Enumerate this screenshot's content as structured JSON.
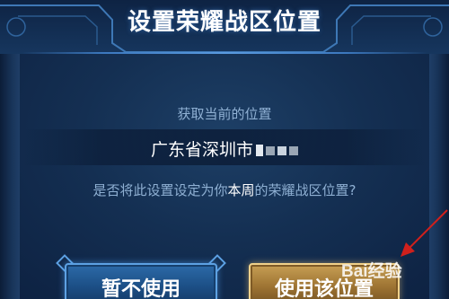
{
  "dialog": {
    "title": "设置荣耀战区位置",
    "prompt": "获取当前的位置",
    "location_text": "广东省深圳市",
    "question_before": "是否将此设置设定为你",
    "question_highlight": "本周",
    "question_after": "的荣耀战区位置?"
  },
  "buttons": {
    "not_use_label": "暂不使用",
    "use_label": "使用该位置"
  },
  "watermark": {
    "text": "Bai经验"
  },
  "colors": {
    "background": "#142f52",
    "title": "#ffffff",
    "muted_text": "#8fb0d3",
    "blue_button": "#1c4f86",
    "gold_button": "#9e7433",
    "annotation_arrow": "#d0201c"
  }
}
